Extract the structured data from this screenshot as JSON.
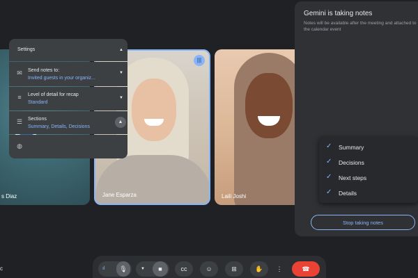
{
  "participants": [
    {
      "name": "s Diaz"
    },
    {
      "name": "Jane Esparza"
    },
    {
      "name": "Laili Joshi"
    }
  ],
  "panel": {
    "title": "Gemini is taking notes",
    "subtitle": "Notes will be available after the meeting and attached to the calendar event",
    "settings_label": "Settings",
    "send_notes": {
      "title": "Send notes to:",
      "value": "Invited guests in your organiz..."
    },
    "detail": {
      "title": "Level of detail for recap",
      "value": "Standard"
    },
    "sections": {
      "title": "Sections",
      "value": "Summary, Details, Decisions"
    },
    "stop_button": "Stop taking notes"
  },
  "sections_dropdown": [
    {
      "label": "Summary",
      "checked": true
    },
    {
      "label": "Decisions",
      "checked": true
    },
    {
      "label": "Next steps",
      "checked": true
    },
    {
      "label": "Details",
      "checked": true
    }
  ],
  "bottom_left_text": "c",
  "icons": {
    "audio": "audio-wave-icon",
    "mic": "mic-icon",
    "camera": "camera-icon",
    "captions": "captions-icon",
    "emoji": "emoji-icon",
    "present": "present-icon",
    "hand": "raise-hand-icon",
    "more": "more-vert-icon",
    "end_call": "end-call-icon"
  },
  "colors": {
    "accent": "#8ab4f8",
    "end_call": "#ea4335",
    "background": "#202124",
    "panel": "#303134"
  }
}
